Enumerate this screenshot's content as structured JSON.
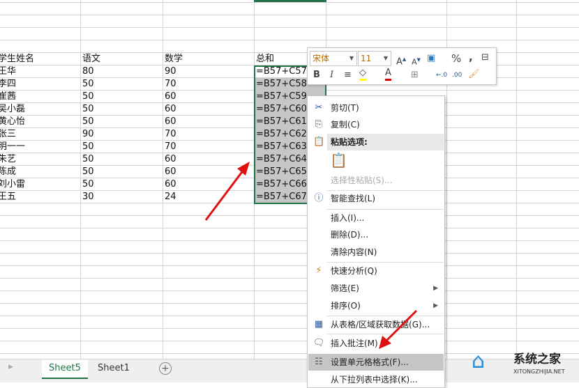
{
  "sheet": {
    "headers": [
      "学生姓名",
      "语文",
      "数学",
      "总和"
    ],
    "rows": [
      [
        "王华",
        "80",
        "90",
        "=B57+C57"
      ],
      [
        "李四",
        "50",
        "70",
        "=B57+C58"
      ],
      [
        "崔茜",
        "50",
        "60",
        "=B57+C59"
      ],
      [
        "吴小磊",
        "50",
        "60",
        "=B57+C60"
      ],
      [
        "黄心怡",
        "50",
        "60",
        "=B57+C61"
      ],
      [
        "张三",
        "90",
        "70",
        "=B57+C62"
      ],
      [
        "明一一",
        "50",
        "70",
        "=B57+C63"
      ],
      [
        "朱艺",
        "50",
        "60",
        "=B57+C64"
      ],
      [
        "陈成",
        "50",
        "60",
        "=B57+C65"
      ],
      [
        "刘小雷",
        "50",
        "60",
        "=B57+C66"
      ],
      [
        "王五",
        "30",
        "24",
        "=B57+C67"
      ]
    ]
  },
  "mini_toolbar": {
    "font": "宋体",
    "size": "11",
    "percent": "%",
    "comma": ","
  },
  "context_menu": {
    "cut": "剪切(T)",
    "copy": "复制(C)",
    "paste_options": "粘贴选项:",
    "paste_special": "选择性粘贴(S)...",
    "smart_lookup": "智能查找(L)",
    "insert": "插入(I)...",
    "delete": "删除(D)...",
    "clear": "清除内容(N)",
    "quick_analysis": "快速分析(Q)",
    "filter": "筛选(E)",
    "sort": "排序(O)",
    "get_data": "从表格/区域获取数据(G)...",
    "insert_comment": "插入批注(M)",
    "format_cells": "设置单元格格式(F)...",
    "pick_list": "从下拉列表中选择(K)..."
  },
  "tabs": [
    "Sheet5",
    "Sheet1"
  ],
  "watermark": {
    "name": "系统之家",
    "url": "XITONGZHIJIA.NET"
  }
}
